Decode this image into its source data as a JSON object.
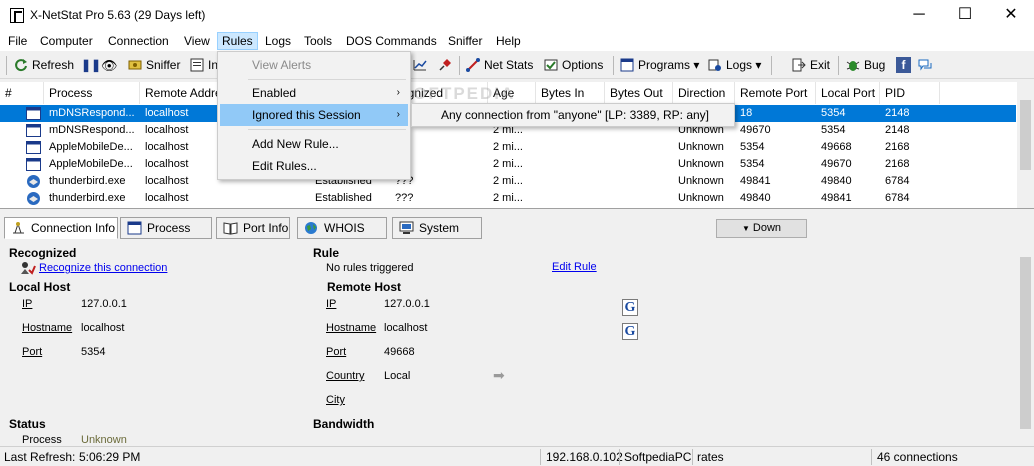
{
  "window": {
    "title": "X-NetStat Pro 5.63 (29 Days left)",
    "minimize_glyph": "─",
    "maximize_glyph": "☐",
    "close_glyph": "✕"
  },
  "menubar": [
    "File",
    "Computer",
    "Connection",
    "View",
    "Rules",
    "Logs",
    "Tools",
    "DOS Commands",
    "Sniffer",
    "Help"
  ],
  "toolbar": {
    "refresh": "Refresh",
    "pause_glyph": "❚❚",
    "binoculars_glyph": "👁",
    "sniffer": "Sniffer",
    "partial": "In",
    "net_stats": "Net Stats",
    "options": "Options",
    "programs": "Programs",
    "logs": "Logs",
    "dropdown_glyph": "▾",
    "exit": "Exit",
    "bug": "Bug",
    "facebook_glyph": "f"
  },
  "grid": {
    "columns": [
      "#",
      "Process",
      "Remote Address",
      "ognized",
      "Age",
      "Bytes In",
      "Bytes Out",
      "Direction",
      "Remote Port",
      "Local Port",
      "PID"
    ],
    "rows": [
      {
        "process": "mDNSRespond...",
        "remote": "localhost",
        "state": "",
        "recognized": "",
        "age": "",
        "direction": "",
        "rport": "18",
        "lport": "5354",
        "pid": "2148"
      },
      {
        "process": "mDNSRespond...",
        "remote": "localhost",
        "state": "",
        "recognized": "",
        "age": "2 mi...",
        "direction": "Unknown",
        "rport": "49670",
        "lport": "5354",
        "pid": "2148"
      },
      {
        "process": "AppleMobileDe...",
        "remote": "localhost",
        "state": "",
        "recognized": "",
        "age": "2 mi...",
        "direction": "Unknown",
        "rport": "5354",
        "lport": "49668",
        "pid": "2168"
      },
      {
        "process": "AppleMobileDe...",
        "remote": "localhost",
        "state": "",
        "recognized": "",
        "age": "2 mi...",
        "direction": "Unknown",
        "rport": "5354",
        "lport": "49670",
        "pid": "2168"
      },
      {
        "process": "thunderbird.exe",
        "remote": "localhost",
        "state": "Established",
        "recognized": "???",
        "age": "2 mi...",
        "direction": "Unknown",
        "rport": "49841",
        "lport": "49840",
        "pid": "6784"
      },
      {
        "process": "thunderbird.exe",
        "remote": "localhost",
        "state": "Established",
        "recognized": "???",
        "age": "2 mi...",
        "direction": "Unknown",
        "rport": "49840",
        "lport": "49841",
        "pid": "6784"
      }
    ]
  },
  "tabs": [
    "Connection Info",
    "Process Info",
    "Port Info",
    "WHOIS Info",
    "System Info"
  ],
  "down_button": "Down",
  "down_glyph": "▼",
  "details": {
    "recognized_title": "Recognized",
    "recognize_link": "Recognize this connection",
    "rule_title": "Rule",
    "rule_value": "No rules triggered",
    "edit_rule_link": "Edit Rule",
    "local_host_title": "Local Host",
    "remote_host_title": "Remote Host",
    "ip_label": "IP",
    "hostname_label": "Hostname",
    "port_label": "Port",
    "country_label": "Country",
    "city_label": "City",
    "local_ip": "127.0.0.1",
    "local_hostname": "localhost",
    "local_port": "5354",
    "remote_ip": "127.0.0.1",
    "remote_hostname": "localhost",
    "remote_port": "49668",
    "remote_country": "Local",
    "remote_city": "",
    "g_glyph": "G",
    "arrow_glyph": "➡",
    "status_title": "Status",
    "bandwidth_title": "Bandwidth",
    "process_label": "Process",
    "process_value": "Unknown",
    "process_value_color": "#6b6b3a"
  },
  "statusbar": {
    "last_refresh_label": "Last Refresh:",
    "last_refresh_value": "5:06:29 PM",
    "ip": "192.168.0.102",
    "computer": "SoftpediaPC",
    "rates": "rates",
    "connections": "46 connections"
  },
  "rules_menu": {
    "items": [
      "View Alerts",
      "Enabled",
      "Ignored this Session",
      "Add New Rule...",
      "Edit Rules..."
    ],
    "submenu_arrow": "›",
    "submenu_item": "Any connection from \"anyone\" [LP: 3389, RP: any]"
  },
  "watermark": "SOFTPEDIA",
  "colors": {
    "selection": "#0078d7",
    "menu_highlight": "#91c9f7",
    "link": "#0000ee"
  }
}
